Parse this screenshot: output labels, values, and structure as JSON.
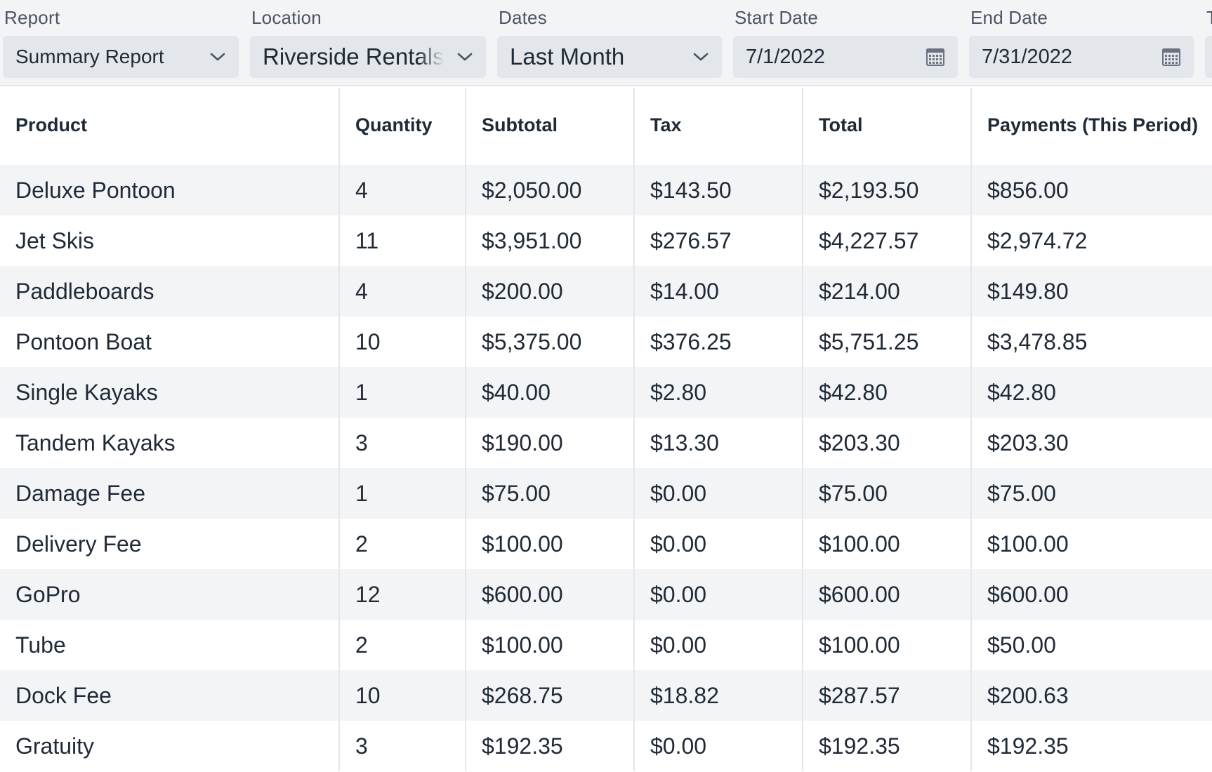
{
  "filters": {
    "report": {
      "label": "Report",
      "value": "Summary Report"
    },
    "location": {
      "label": "Location",
      "value": "Riverside Rentals"
    },
    "dates": {
      "label": "Dates",
      "value": "Last Month"
    },
    "start_date": {
      "label": "Start Date",
      "value": "7/1/2022"
    },
    "end_date": {
      "label": "End Date",
      "value": "7/31/2022"
    },
    "next_label_fragment": "T"
  },
  "table": {
    "columns": [
      "Product",
      "Quantity",
      "Subtotal",
      "Tax",
      "Total",
      "Payments (This Period)"
    ],
    "rows": [
      [
        "Deluxe Pontoon",
        "4",
        "$2,050.00",
        "$143.50",
        "$2,193.50",
        "$856.00"
      ],
      [
        "Jet Skis",
        "11",
        "$3,951.00",
        "$276.57",
        "$4,227.57",
        "$2,974.72"
      ],
      [
        "Paddleboards",
        "4",
        "$200.00",
        "$14.00",
        "$214.00",
        "$149.80"
      ],
      [
        "Pontoon Boat",
        "10",
        "$5,375.00",
        "$376.25",
        "$5,751.25",
        "$3,478.85"
      ],
      [
        "Single Kayaks",
        "1",
        "$40.00",
        "$2.80",
        "$42.80",
        "$42.80"
      ],
      [
        "Tandem Kayaks",
        "3",
        "$190.00",
        "$13.30",
        "$203.30",
        "$203.30"
      ],
      [
        "Damage Fee",
        "1",
        "$75.00",
        "$0.00",
        "$75.00",
        "$75.00"
      ],
      [
        "Delivery Fee",
        "2",
        "$100.00",
        "$0.00",
        "$100.00",
        "$100.00"
      ],
      [
        "GoPro",
        "12",
        "$600.00",
        "$0.00",
        "$600.00",
        "$600.00"
      ],
      [
        "Tube",
        "2",
        "$100.00",
        "$0.00",
        "$100.00",
        "$50.00"
      ],
      [
        "Dock Fee",
        "10",
        "$268.75",
        "$18.82",
        "$287.57",
        "$200.63"
      ],
      [
        "Gratuity",
        "3",
        "$192.35",
        "$0.00",
        "$192.35",
        "$192.35"
      ]
    ]
  },
  "icons": {
    "dropdown": "chevron-down-icon",
    "date_picker": "calendar-icon"
  },
  "colors": {
    "filter_bar_bg": "#f3f4f6",
    "control_bg": "#e3e6ea",
    "text": "#1f2a37",
    "label": "#4b5563",
    "row_stripe": "#f3f4f6"
  }
}
